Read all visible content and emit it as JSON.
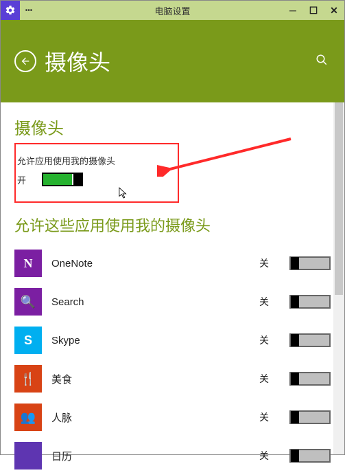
{
  "titlebar": {
    "title": "电脑设置",
    "dots": "•••"
  },
  "header": {
    "title": "摄像头"
  },
  "section1": {
    "title": "摄像头",
    "perm_label": "允许应用使用我的摄像头",
    "state": "开"
  },
  "section2": {
    "title": "允许这些应用使用我的摄像头"
  },
  "apps": [
    {
      "name": "OneNote",
      "state": "关",
      "icon_class": "ic-onenote",
      "glyph": "N"
    },
    {
      "name": "Search",
      "state": "关",
      "icon_class": "ic-search",
      "glyph": "🔍"
    },
    {
      "name": "Skype",
      "state": "关",
      "icon_class": "ic-skype",
      "glyph": "S"
    },
    {
      "name": "美食",
      "state": "关",
      "icon_class": "ic-food",
      "glyph": "🍴"
    },
    {
      "name": "人脉",
      "state": "关",
      "icon_class": "ic-people",
      "glyph": "👥"
    },
    {
      "name": "日历",
      "state": "关",
      "icon_class": "ic-calendar",
      "glyph": ""
    }
  ]
}
